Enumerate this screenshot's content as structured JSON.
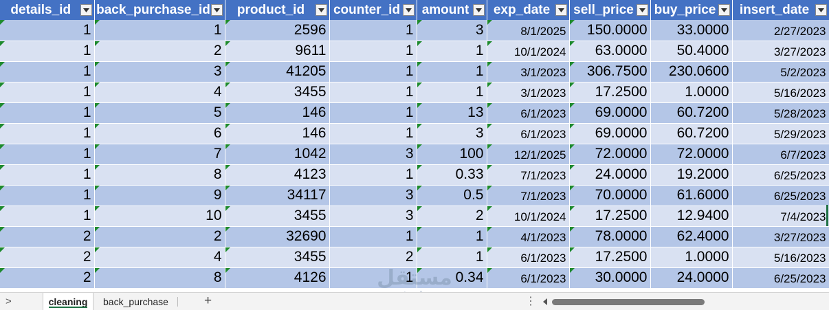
{
  "columns": [
    "details_id",
    "back_purchase_id",
    "product_id",
    "counter_id",
    "amount",
    "exp_date",
    "sell_price",
    "buy_price",
    "insert_date"
  ],
  "rows": [
    [
      "1",
      "1",
      "2596",
      "1",
      "3",
      "8/1/2025",
      "150.0000",
      "33.0000",
      "2/27/2023"
    ],
    [
      "1",
      "2",
      "9611",
      "1",
      "1",
      "10/1/2024",
      "63.0000",
      "50.4000",
      "3/27/2023"
    ],
    [
      "1",
      "3",
      "41205",
      "1",
      "1",
      "3/1/2023",
      "306.7500",
      "230.0600",
      "5/2/2023"
    ],
    [
      "1",
      "4",
      "3455",
      "1",
      "1",
      "3/1/2023",
      "17.2500",
      "1.0000",
      "5/16/2023"
    ],
    [
      "1",
      "5",
      "146",
      "1",
      "13",
      "6/1/2023",
      "69.0000",
      "60.7200",
      "5/28/2023"
    ],
    [
      "1",
      "6",
      "146",
      "1",
      "3",
      "6/1/2023",
      "69.0000",
      "60.7200",
      "5/29/2023"
    ],
    [
      "1",
      "7",
      "1042",
      "3",
      "100",
      "12/1/2025",
      "72.0000",
      "72.0000",
      "6/7/2023"
    ],
    [
      "1",
      "8",
      "4123",
      "1",
      "0.33",
      "7/1/2023",
      "24.0000",
      "19.2000",
      "6/25/2023"
    ],
    [
      "1",
      "9",
      "34117",
      "3",
      "0.5",
      "7/1/2023",
      "70.0000",
      "61.6000",
      "6/25/2023"
    ],
    [
      "1",
      "10",
      "3455",
      "3",
      "2",
      "10/1/2024",
      "17.2500",
      "12.9400",
      "7/4/2023"
    ],
    [
      "2",
      "2",
      "32690",
      "1",
      "1",
      "4/1/2023",
      "78.0000",
      "62.4000",
      "3/27/2023"
    ],
    [
      "2",
      "4",
      "3455",
      "2",
      "1",
      "6/1/2023",
      "17.2500",
      "1.0000",
      "5/16/2023"
    ],
    [
      "2",
      "8",
      "4126",
      "1",
      "0.34",
      "6/1/2023",
      "30.0000",
      "24.0000",
      "6/25/2023"
    ]
  ],
  "sheet_tabs": {
    "active": "cleaning",
    "other": "back_purchase",
    "add_symbol": "+",
    "nav_symbol": ">",
    "more_symbol": "⋮"
  },
  "watermark": {
    "arabic": "مستقل",
    "latin": "mostaql.com"
  },
  "colors": {
    "header_bg": "#4472c4",
    "row_band_dark": "#b4c6e7",
    "row_band_light": "#d9e1f2",
    "error_indicator": "#1e8a2e",
    "selection": "#217346"
  }
}
